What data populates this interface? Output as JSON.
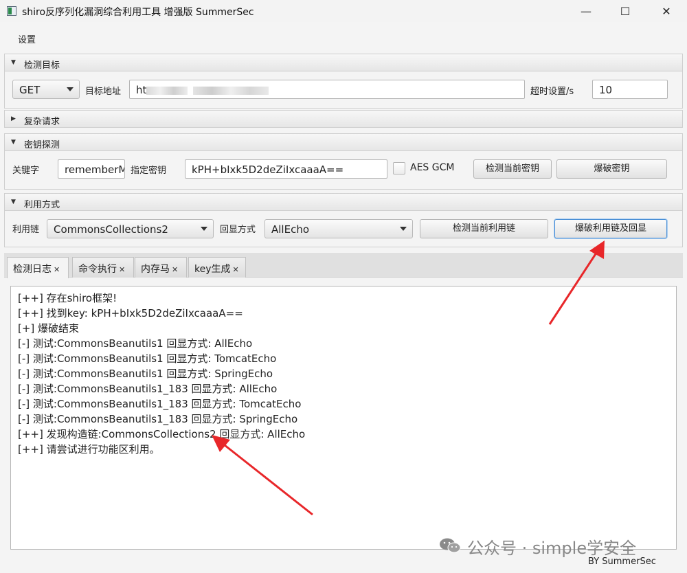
{
  "window": {
    "title": "shiro反序列化漏洞综合利用工具 增强版 SummerSec",
    "minimize": "—",
    "maximize": "☐",
    "close": "✕"
  },
  "menu": {
    "settings": "设置"
  },
  "sections": {
    "target": {
      "title": "检测目标",
      "method": "GET",
      "url_label": "目标地址",
      "url_prefix": "ht",
      "timeout_label": "超时设置/s",
      "timeout_value": "10"
    },
    "complex": {
      "title": "复杂请求"
    },
    "key": {
      "title": "密钥探测",
      "keyword_label": "关键字",
      "keyword_value": "rememberMe",
      "key_label": "指定密钥",
      "key_value": "kPH+bIxk5D2deZiIxcaaaA==",
      "aes_gcm_label": "AES GCM",
      "check_key_button": "检测当前密钥",
      "brute_key_button": "爆破密钥"
    },
    "exploit": {
      "title": "利用方式",
      "chain_label": "利用链",
      "chain_value": "CommonsCollections2",
      "echo_label": "回显方式",
      "echo_value": "AllEcho",
      "check_chain_button": "检测当前利用链",
      "brute_chain_button": "爆破利用链及回显"
    }
  },
  "tabs": [
    {
      "label": "检测日志",
      "close": "✕"
    },
    {
      "label": "命令执行",
      "close": "✕"
    },
    {
      "label": "内存马",
      "close": "✕"
    },
    {
      "label": "key生成",
      "close": "✕"
    }
  ],
  "log": [
    "[++] 存在shiro框架!",
    "[++] 找到key:  kPH+bIxk5D2deZiIxcaaaA==",
    "[+] 爆破结束",
    "[-] 测试:CommonsBeanutils1  回显方式: AllEcho",
    "[-] 测试:CommonsBeanutils1  回显方式: TomcatEcho",
    "[-] 测试:CommonsBeanutils1  回显方式: SpringEcho",
    "[-] 测试:CommonsBeanutils1_183  回显方式: AllEcho",
    "[-] 测试:CommonsBeanutils1_183  回显方式: TomcatEcho",
    "[-] 测试:CommonsBeanutils1_183  回显方式: SpringEcho",
    "[++] 发现构造链:CommonsCollections2  回显方式: AllEcho",
    "[++] 请尝试进行功能区利用。"
  ],
  "watermark": "公众号 · simple学安全",
  "status": "BY   SummerSec",
  "colors": {
    "annotation_arrow": "#e8272a",
    "focus_border": "#4a8fd6"
  }
}
